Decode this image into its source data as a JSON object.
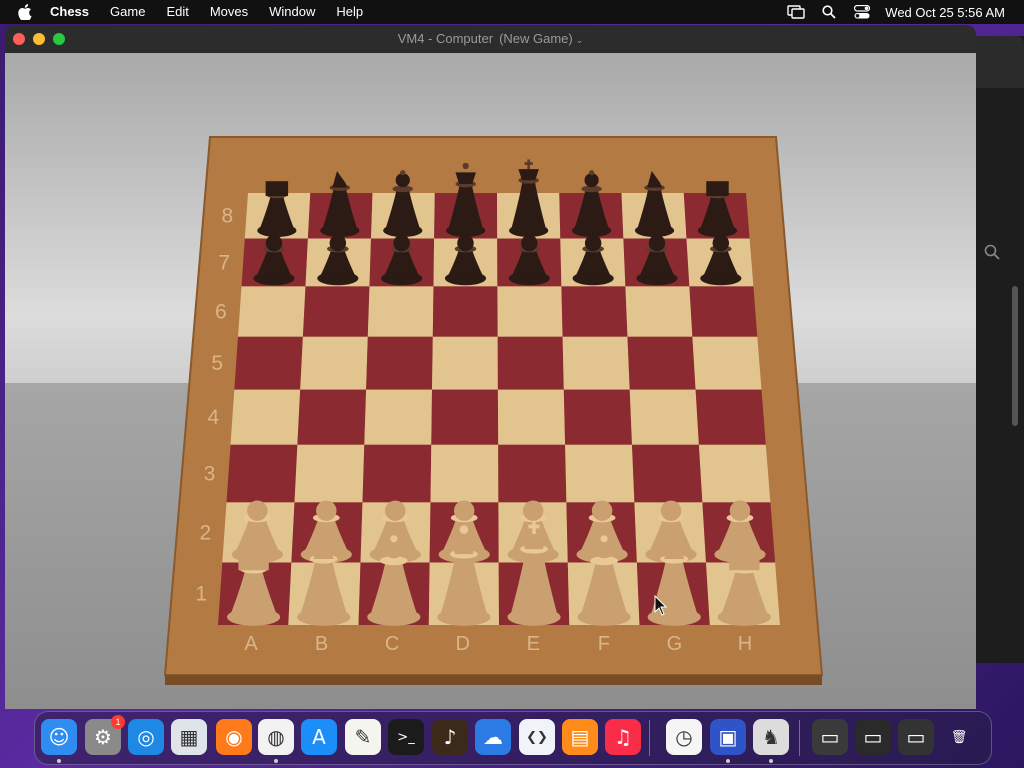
{
  "menubar": {
    "app_name": "Chess",
    "items": [
      "Game",
      "Edit",
      "Moves",
      "Window",
      "Help"
    ],
    "clock": "Wed Oct 25  5:56 AM"
  },
  "window": {
    "title": "VM4 - Computer",
    "subtitle": "(New Game)"
  },
  "board": {
    "files": [
      "A",
      "B",
      "C",
      "D",
      "E",
      "F",
      "G",
      "H"
    ],
    "ranks": [
      "8",
      "7",
      "6",
      "5",
      "4",
      "3",
      "2",
      "1"
    ],
    "colors": {
      "light": "#e2c48f",
      "dark": "#8c2a31",
      "frame": "#b47a43"
    },
    "pieces": [
      {
        "square": "a8",
        "type": "rook",
        "color": "black"
      },
      {
        "square": "b8",
        "type": "knight",
        "color": "black"
      },
      {
        "square": "c8",
        "type": "bishop",
        "color": "black"
      },
      {
        "square": "d8",
        "type": "queen",
        "color": "black"
      },
      {
        "square": "e8",
        "type": "king",
        "color": "black"
      },
      {
        "square": "f8",
        "type": "bishop",
        "color": "black"
      },
      {
        "square": "g8",
        "type": "knight",
        "color": "black"
      },
      {
        "square": "h8",
        "type": "rook",
        "color": "black"
      },
      {
        "square": "a7",
        "type": "pawn",
        "color": "black"
      },
      {
        "square": "b7",
        "type": "pawn",
        "color": "black"
      },
      {
        "square": "c7",
        "type": "pawn",
        "color": "black"
      },
      {
        "square": "d7",
        "type": "pawn",
        "color": "black"
      },
      {
        "square": "e7",
        "type": "pawn",
        "color": "black"
      },
      {
        "square": "f7",
        "type": "pawn",
        "color": "black"
      },
      {
        "square": "g7",
        "type": "pawn",
        "color": "black"
      },
      {
        "square": "h7",
        "type": "pawn",
        "color": "black"
      },
      {
        "square": "a2",
        "type": "pawn",
        "color": "white"
      },
      {
        "square": "b2",
        "type": "pawn",
        "color": "white"
      },
      {
        "square": "c2",
        "type": "pawn",
        "color": "white"
      },
      {
        "square": "d2",
        "type": "pawn",
        "color": "white"
      },
      {
        "square": "e2",
        "type": "pawn",
        "color": "white"
      },
      {
        "square": "f2",
        "type": "pawn",
        "color": "white"
      },
      {
        "square": "g2",
        "type": "pawn",
        "color": "white"
      },
      {
        "square": "h2",
        "type": "pawn",
        "color": "white"
      },
      {
        "square": "a1",
        "type": "rook",
        "color": "white"
      },
      {
        "square": "b1",
        "type": "knight",
        "color": "white"
      },
      {
        "square": "c1",
        "type": "bishop",
        "color": "white"
      },
      {
        "square": "d1",
        "type": "queen",
        "color": "white"
      },
      {
        "square": "e1",
        "type": "king",
        "color": "white"
      },
      {
        "square": "f1",
        "type": "bishop",
        "color": "white"
      },
      {
        "square": "g1",
        "type": "knight",
        "color": "white"
      },
      {
        "square": "h1",
        "type": "rook",
        "color": "white"
      }
    ]
  },
  "dock": {
    "items": [
      {
        "name": "finder-icon",
        "glyph": "☺",
        "bg": "#2f8cf0",
        "running": true
      },
      {
        "name": "system-settings-icon",
        "glyph": "⚙",
        "bg": "#8a8a8a",
        "badge": "1"
      },
      {
        "name": "safari-icon",
        "glyph": "◎",
        "bg": "#1e88e5"
      },
      {
        "name": "launchpad-icon",
        "glyph": "▦",
        "bg": "#dfe3ea"
      },
      {
        "name": "firefox-icon",
        "glyph": "◉",
        "bg": "#ff7a1a"
      },
      {
        "name": "chrome-icon",
        "glyph": "◍",
        "bg": "#f2f2f2",
        "running": true
      },
      {
        "name": "app-store-icon",
        "glyph": "A",
        "bg": "#1c8ef9"
      },
      {
        "name": "textedit-icon",
        "glyph": "✎",
        "bg": "#f5f5f0"
      },
      {
        "name": "terminal-icon",
        "glyph": ">_",
        "bg": "#1b1b1b"
      },
      {
        "name": "garageband-icon",
        "glyph": "♪",
        "bg": "#3b2a1a"
      },
      {
        "name": "weather-icon",
        "glyph": "☁",
        "bg": "#2c7be5"
      },
      {
        "name": "vscode-icon",
        "glyph": "❮❯",
        "bg": "#f0f4fa"
      },
      {
        "name": "books-icon",
        "glyph": "▤",
        "bg": "#ff8c1a"
      },
      {
        "name": "music-icon",
        "glyph": "♫",
        "bg": "#fa2d48"
      },
      {
        "name": "clock-icon",
        "glyph": "◷",
        "bg": "#f5f5f5"
      },
      {
        "name": "screen-sharing-icon",
        "glyph": "▣",
        "bg": "#2f54c8",
        "running": true
      },
      {
        "name": "chess-icon",
        "glyph": "♞",
        "bg": "#dcdcdc",
        "running": true
      },
      {
        "name": "window-thumbnail-icon",
        "glyph": "▭",
        "bg": "#3a3a3a"
      },
      {
        "name": "chrome-window-thumbnail-icon",
        "glyph": "▭",
        "bg": "#2a2a2a"
      },
      {
        "name": "vm-window-thumbnail-icon",
        "glyph": "▭",
        "bg": "#333333"
      },
      {
        "name": "trash-icon",
        "glyph": "🗑",
        "bg": "transparent"
      }
    ]
  }
}
